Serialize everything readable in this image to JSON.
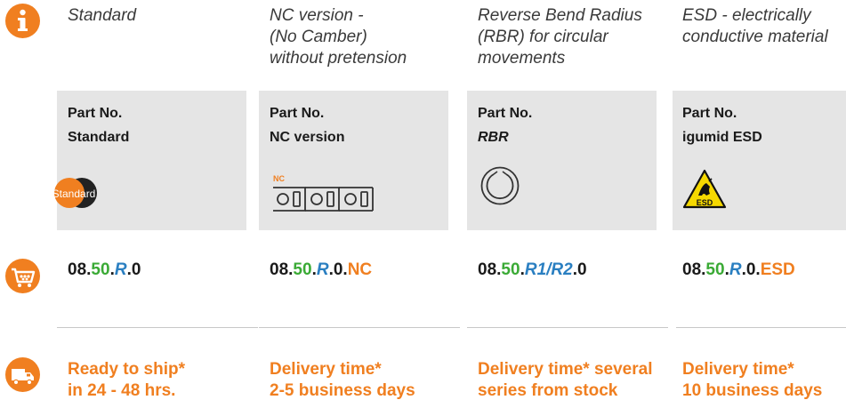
{
  "icons": {
    "info": "info-icon",
    "cart": "shopping-cart-icon",
    "truck": "delivery-truck-icon"
  },
  "colors": {
    "accent_orange": "#f07f20",
    "green": "#3aaa35",
    "blue": "#2a7fc1",
    "box_gray": "#e5e5e5"
  },
  "columns": [
    {
      "desc_lines": [
        "Standard"
      ],
      "pn_label": "Part No.",
      "pn_value": "Standard",
      "badge_text": "Standard",
      "part_number": {
        "prefix": "08.",
        "green": "50",
        "dot1": ".",
        "blue": "R",
        "dot2": ".0",
        "orange": ""
      },
      "delivery_lines": [
        "Ready to ship*",
        "in 24 - 48 hrs."
      ]
    },
    {
      "desc_lines": [
        "NC version -",
        "(No Camber)",
        "without pretension"
      ],
      "pn_label": "Part No.",
      "pn_value": "NC version",
      "badge_text": "NC",
      "part_number": {
        "prefix": "08.",
        "green": "50",
        "dot1": ".",
        "blue": "R",
        "dot2": ".0.",
        "orange": "NC"
      },
      "delivery_lines": [
        "Delivery time*",
        "2-5 business days"
      ]
    },
    {
      "desc_lines": [
        "Reverse Bend Radius",
        "(RBR) for circular",
        "movements"
      ],
      "pn_label": "Part No.",
      "pn_value": "RBR",
      "badge_text": "",
      "part_number": {
        "prefix": "08.",
        "green": "50",
        "dot1": ".",
        "blue": "R1/R2",
        "dot2": ".0",
        "orange": ""
      },
      "delivery_lines": [
        "Delivery time* several",
        "series from stock"
      ]
    },
    {
      "desc_lines": [
        "ESD - electrically",
        "conductive material"
      ],
      "pn_label": "Part No.",
      "pn_value": "igumid ESD",
      "badge_text": "ESD",
      "part_number": {
        "prefix": "08.",
        "green": "50",
        "dot1": ".",
        "blue": "R",
        "dot2": ".0.",
        "orange": "ESD"
      },
      "delivery_lines": [
        "Delivery time*",
        "10 business days"
      ]
    }
  ]
}
